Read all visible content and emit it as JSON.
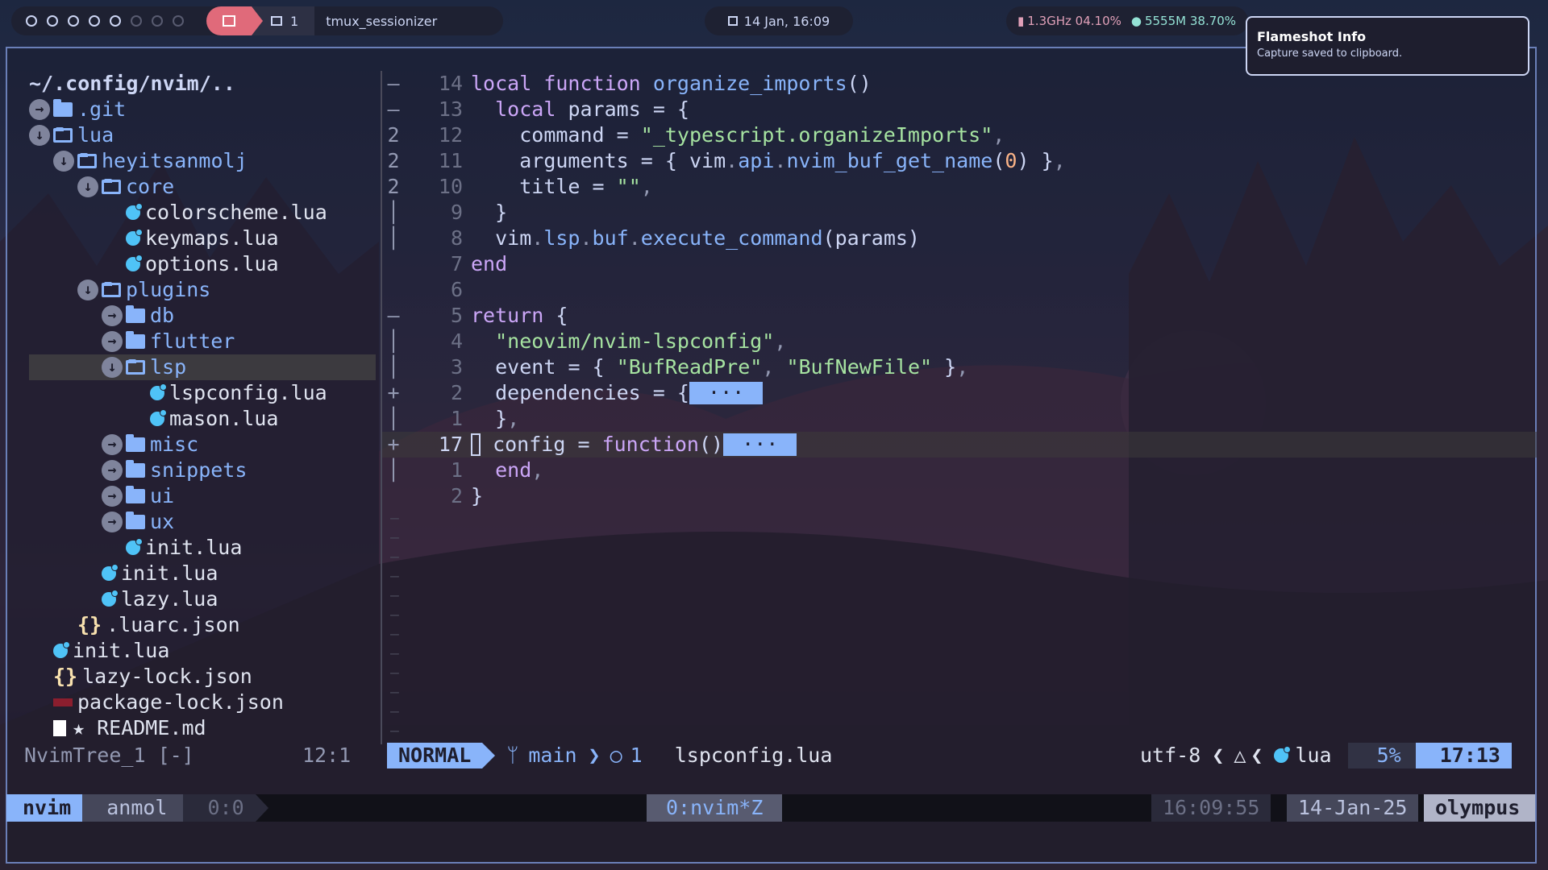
{
  "topbar": {
    "workspace_num": "1",
    "window_title": "tmux_sessionizer",
    "datetime": "14 Jan, 16:09",
    "cpu": "1.3GHz 04.10%",
    "mem": "5555M 38.70%"
  },
  "notification": {
    "title": "Flameshot Info",
    "body": "Capture saved to clipboard."
  },
  "tree": {
    "root": "~/.config/nvim/..",
    "items": [
      {
        "name": ".git",
        "kind": "folder",
        "depth": 0,
        "open": false
      },
      {
        "name": "lua",
        "kind": "folder",
        "depth": 0,
        "open": true
      },
      {
        "name": "heyitsanmolj",
        "kind": "folder",
        "depth": 1,
        "open": true
      },
      {
        "name": "core",
        "kind": "folder",
        "depth": 2,
        "open": true
      },
      {
        "name": "colorscheme.lua",
        "kind": "lua",
        "depth": 3
      },
      {
        "name": "keymaps.lua",
        "kind": "lua",
        "depth": 3
      },
      {
        "name": "options.lua",
        "kind": "lua",
        "depth": 3
      },
      {
        "name": "plugins",
        "kind": "folder",
        "depth": 2,
        "open": true
      },
      {
        "name": "db",
        "kind": "folder",
        "depth": 3,
        "open": false
      },
      {
        "name": "flutter",
        "kind": "folder",
        "depth": 3,
        "open": false
      },
      {
        "name": "lsp",
        "kind": "folder",
        "depth": 3,
        "open": true,
        "selected": true
      },
      {
        "name": "lspconfig.lua",
        "kind": "lua",
        "depth": 4
      },
      {
        "name": "mason.lua",
        "kind": "lua",
        "depth": 4
      },
      {
        "name": "misc",
        "kind": "folder",
        "depth": 3,
        "open": false
      },
      {
        "name": "snippets",
        "kind": "folder",
        "depth": 3,
        "open": false
      },
      {
        "name": "ui",
        "kind": "folder",
        "depth": 3,
        "open": false
      },
      {
        "name": "ux",
        "kind": "folder",
        "depth": 3,
        "open": false
      },
      {
        "name": "init.lua",
        "kind": "lua",
        "depth": 3
      },
      {
        "name": "init.lua",
        "kind": "lua",
        "depth": 2
      },
      {
        "name": "lazy.lua",
        "kind": "lua",
        "depth": 2
      },
      {
        "name": ".luarc.json",
        "kind": "json",
        "depth": 1
      },
      {
        "name": "init.lua",
        "kind": "lua",
        "depth": 0
      },
      {
        "name": "lazy-lock.json",
        "kind": "json",
        "depth": 0
      },
      {
        "name": "package-lock.json",
        "kind": "pkg",
        "depth": 0
      },
      {
        "name": "★ README.md",
        "kind": "md",
        "depth": 0
      }
    ],
    "status_name": "NvimTree_1 [-]",
    "status_pos": "12:1"
  },
  "editor": {
    "gutter": [
      {
        "fold": "–",
        "num": "14"
      },
      {
        "fold": "–",
        "num": "13"
      },
      {
        "fold": "2",
        "num": "12"
      },
      {
        "fold": "2",
        "num": "11"
      },
      {
        "fold": "2",
        "num": "10"
      },
      {
        "fold": "│",
        "num": "9"
      },
      {
        "fold": "│",
        "num": "8"
      },
      {
        "fold": "",
        "num": "7"
      },
      {
        "fold": "",
        "num": "6"
      },
      {
        "fold": "–",
        "num": "5"
      },
      {
        "fold": "│",
        "num": "4"
      },
      {
        "fold": "│",
        "num": "3"
      },
      {
        "fold": "+",
        "num": "2"
      },
      {
        "fold": "│",
        "num": "1"
      },
      {
        "fold": "+",
        "num": "17"
      },
      {
        "fold": "│",
        "num": "1"
      },
      {
        "fold": "",
        "num": "2"
      }
    ],
    "lines": [
      {
        "code": "local function organize_imports()"
      },
      {
        "code": "  local params = {"
      },
      {
        "code": "    command = \"_typescript.organizeImports\","
      },
      {
        "code": "    arguments = { vim.api.nvim_buf_get_name(0) },"
      },
      {
        "code": "    title = \"\","
      },
      {
        "code": "  }"
      },
      {
        "code": "  vim.lsp.buf.execute_command(params)"
      },
      {
        "code": "end"
      },
      {
        "code": ""
      },
      {
        "code": "return {"
      },
      {
        "code": "  \"neovim/nvim-lspconfig\","
      },
      {
        "code": "  event = { \"BufReadPre\", \"BufNewFile\" },"
      },
      {
        "code": "  dependencies = {",
        "fold": " ··· "
      },
      {
        "code": "  },"
      },
      {
        "code": "  config = function()",
        "fold": " ··· ",
        "cursor": true
      },
      {
        "code": "  end,"
      },
      {
        "code": "}"
      }
    ],
    "fold_marker": "···"
  },
  "statusline": {
    "mode": "NORMAL",
    "branch": "main",
    "diagnostics": "1",
    "filename": "lspconfig.lua",
    "encoding": "utf-8",
    "filetype": "lua",
    "percent": "5%",
    "position": "17:13"
  },
  "tmux": {
    "app": "nvim",
    "user": "anmol",
    "pane": "0:0",
    "window": "0:nvim*Z",
    "time": "16:09:55",
    "date": "14-Jan-25",
    "host": "olympus"
  },
  "colors": {
    "accent": "#89b4fa",
    "workspace_active": "#e06a7a",
    "frame": "#6a7fb8"
  }
}
